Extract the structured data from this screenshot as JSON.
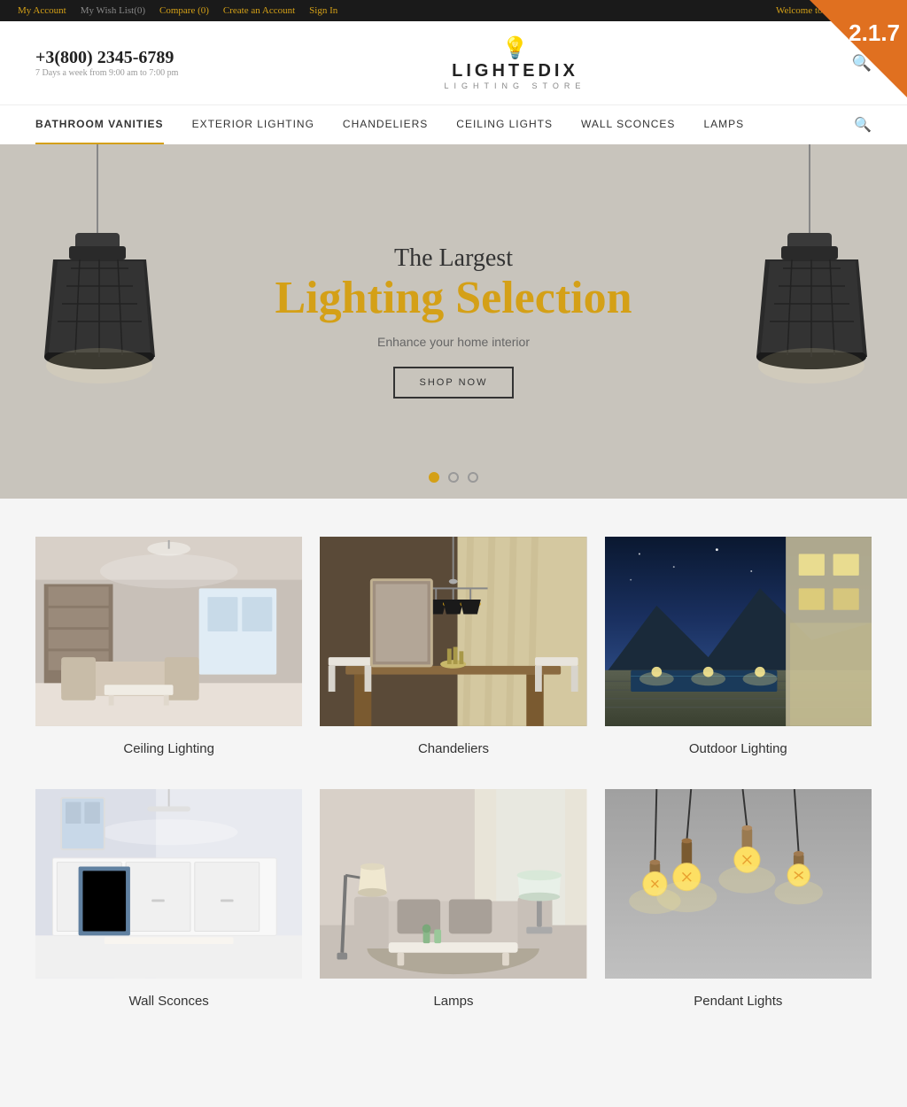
{
  "topbar": {
    "links": [
      {
        "label": "My Account",
        "id": "my-account"
      },
      {
        "label": "My Wish List",
        "id": "wish-list"
      },
      {
        "label": "(0)",
        "id": "wish-count"
      },
      {
        "label": "Compare (0)",
        "id": "compare"
      },
      {
        "label": "Create an Account",
        "id": "create-account"
      },
      {
        "label": "Sign In",
        "id": "sign-in"
      }
    ],
    "welcome": "Welcome to our online store!"
  },
  "version": "2.1.7",
  "header": {
    "phone": "+3(800) 2345-6789",
    "hours": "7 Days a week from 9:00 am to 7:00 pm",
    "logo_text": "LIGHTEDIX",
    "logo_sub": "LIGHTING STORE"
  },
  "nav": {
    "items": [
      {
        "label": "BATHROOM VANITIES",
        "active": true,
        "id": "nav-bathroom"
      },
      {
        "label": "EXTERIOR LIGHTING",
        "active": false,
        "id": "nav-exterior"
      },
      {
        "label": "CHANDELIERS",
        "active": false,
        "id": "nav-chandeliers"
      },
      {
        "label": "CEILING LIGHTS",
        "active": false,
        "id": "nav-ceiling"
      },
      {
        "label": "WALL SCONCES",
        "active": false,
        "id": "nav-wall"
      },
      {
        "label": "LAMPS",
        "active": false,
        "id": "nav-lamps"
      }
    ]
  },
  "hero": {
    "subtitle": "The Largest",
    "title": "Lighting Selection",
    "description": "Enhance your home interior",
    "cta_label": "SHOP NOW",
    "dots": [
      {
        "active": true
      },
      {
        "active": false
      },
      {
        "active": false
      }
    ]
  },
  "categories": {
    "row1": [
      {
        "label": "Ceiling Lighting",
        "id": "cat-ceiling"
      },
      {
        "label": "Chandeliers",
        "id": "cat-chandeliers"
      },
      {
        "label": "Outdoor Lighting",
        "id": "cat-outdoor"
      }
    ],
    "row2": [
      {
        "label": "Wall Sconces",
        "id": "cat-wall"
      },
      {
        "label": "Lamps",
        "id": "cat-lamps"
      },
      {
        "label": "Pendant Lights",
        "id": "cat-pendant"
      }
    ]
  },
  "colors": {
    "accent": "#d4a017",
    "dark": "#1a1a1a",
    "text": "#333333",
    "orange_badge": "#e07020"
  }
}
